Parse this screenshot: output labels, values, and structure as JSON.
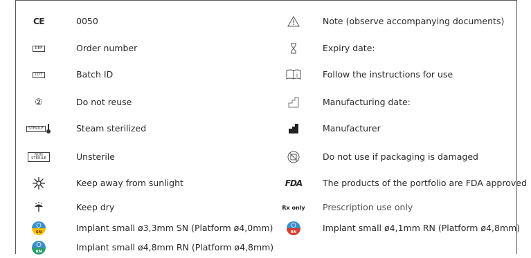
{
  "left": [
    {
      "icon": "ce-mark-icon",
      "label": "0050"
    },
    {
      "icon": "ref-icon",
      "label": "Order number",
      "box": "REF"
    },
    {
      "icon": "lot-icon",
      "label": "Batch ID",
      "box": "LOT"
    },
    {
      "icon": "do-not-reuse-icon",
      "label": "Do not reuse",
      "glyph": "②"
    },
    {
      "icon": "steam-sterilized-icon",
      "label": "Steam sterilized",
      "box": "STERILE"
    },
    {
      "icon": "non-sterile-icon",
      "label": "Unsterile",
      "box": "NON STERILE"
    },
    {
      "icon": "keep-away-from-sunlight-icon",
      "label": "Keep away from sunlight"
    },
    {
      "icon": "keep-dry-icon",
      "label": "Keep dry"
    },
    {
      "icon": "implant-sn-badge-icon",
      "label": "Implant small ø3,3mm SN (Platform ø4,0mm)",
      "badge": "SN",
      "colors": [
        "#3b8fc9",
        "#f2c200"
      ]
    },
    {
      "icon": "implant-rn-badge-icon",
      "label": "Implant small ø4,8mm RN (Platform ø4,8mm)",
      "badge": "RN",
      "colors": [
        "#3b8fc9",
        "#2a9d6a"
      ]
    }
  ],
  "right": [
    {
      "icon": "warning-triangle-icon",
      "label": "Note (observe accompanying documents)"
    },
    {
      "icon": "hourglass-icon",
      "label": "Expiry date:"
    },
    {
      "icon": "instructions-book-icon",
      "label": "Follow the instructions for use"
    },
    {
      "icon": "manufacturing-date-icon",
      "label": "Manufacturing date:"
    },
    {
      "icon": "manufacturer-icon",
      "label": "Manufacturer"
    },
    {
      "icon": "damaged-packaging-icon",
      "label": "Do not use if packaging is damaged"
    },
    {
      "icon": "fda-logo-icon",
      "label": "The products of the portfolio are FDA approved",
      "logo": "FDA"
    },
    {
      "icon": "rx-only-icon",
      "label": "Prescription use only",
      "logo": "Rx only"
    },
    {
      "icon": "implant-rn-badge-red-icon",
      "label": "Implant small ø4,1mm RN (Platform ø4,8mm)",
      "badge": "RN",
      "colors": [
        "#3b8fc9",
        "#d93a2b"
      ]
    }
  ],
  "colors": {
    "border": "#5a5a5a",
    "text": "#2a2a2a"
  }
}
